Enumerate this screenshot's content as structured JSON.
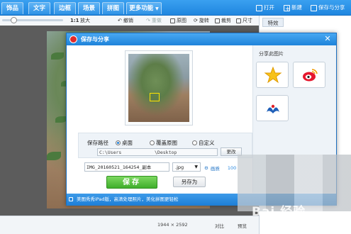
{
  "nav": {
    "tabs": [
      "饰品",
      "文字",
      "边框",
      "场景",
      "拼图",
      "更多功能"
    ],
    "actions": [
      "打开",
      "新建",
      "保存与分享"
    ]
  },
  "toolbar": {
    "ratio": "1:1",
    "enlarge": "放大",
    "undo": "撤销",
    "redo": "重做",
    "original": "原图",
    "rotate": "旋转",
    "crop": "裁剪",
    "resize": "尺寸"
  },
  "status": {
    "dimensions": "1944 × 2592",
    "compare": "对比",
    "preview": "预览"
  },
  "right_panel": {
    "tab": "特效"
  },
  "dialog": {
    "title": "保存与分享",
    "save_path_label": "保存路径",
    "options": [
      "桌面",
      "覆盖原图",
      "自定义"
    ],
    "selected_option": "桌面",
    "path_prefix": "C:\\Users",
    "path_suffix": "\\Desktop",
    "change_label": "更改",
    "filename": "IMG_20160521_164254_副本",
    "format": ".jpg",
    "quality_label": "画质",
    "quality_value": "100",
    "save_label": "保存",
    "saveas_label": "另存为",
    "share_title": "分享此图片",
    "tip": "美图秀秀iPad版，高清处理照片，美化拼图更轻松"
  },
  "watermark": "Bai 经验",
  "colors": {
    "accent_blue": "#1f86df",
    "save_green": "#3fae2b",
    "weibo_red": "#e6162d"
  }
}
